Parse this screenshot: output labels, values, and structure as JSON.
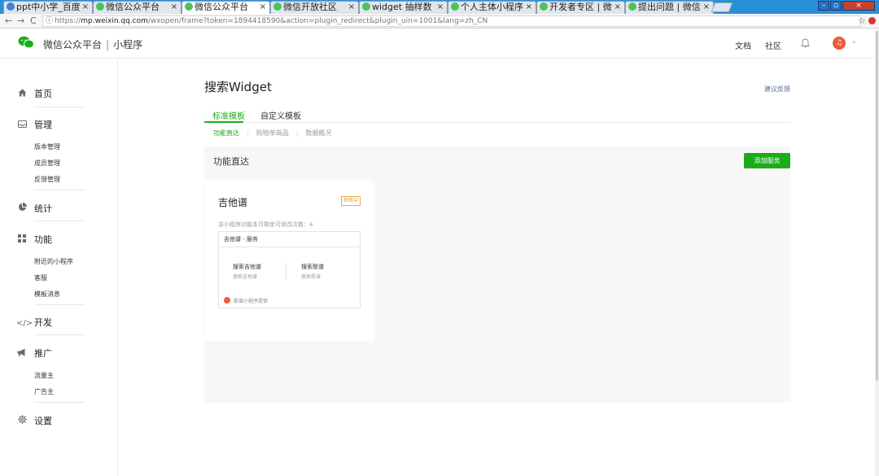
{
  "browser": {
    "tabs": [
      {
        "label": "ppt中小学_百度",
        "icon": "baidu"
      },
      {
        "label": "微信公众平台",
        "icon": "wechat"
      },
      {
        "label": "微信公众平台",
        "icon": "wechat",
        "active": true
      },
      {
        "label": "微信开放社区",
        "icon": "wechat"
      },
      {
        "label": "widget 抽样数",
        "icon": "wechat"
      },
      {
        "label": "个人主体小程序",
        "icon": "wechat"
      },
      {
        "label": "开发者专区 | 微",
        "icon": "wechat"
      },
      {
        "label": "提出问题 | 微信",
        "icon": "wechat"
      }
    ],
    "tab_close": "×",
    "url_scheme": "https://",
    "url_host": "mp.weixin.qq.com",
    "url_path": "/wxopen/frame?token=1894418590&action=plugin_redirect&plugin_uin=1001&lang=zh_CN",
    "back": "←",
    "forward": "→",
    "reload": "C",
    "star": "☆",
    "win_min": "–",
    "win_max": "▫",
    "win_close": "×"
  },
  "header": {
    "brand": "微信公众平台",
    "separator": "|",
    "section": "小程序",
    "docs": "文档",
    "community": "社区",
    "avatar_glyph": "♫",
    "caret": "⌄"
  },
  "sidebar": {
    "home": "首页",
    "manage": "管理",
    "manage_items": [
      "版本管理",
      "成员管理",
      "反馈管理"
    ],
    "stats": "统计",
    "features": "功能",
    "feature_items": [
      "附近的小程序",
      "客服",
      "模板消息"
    ],
    "dev": "开发",
    "promote": "推广",
    "promote_items": [
      "流量主",
      "广告主"
    ],
    "settings": "设置"
  },
  "main": {
    "title": "搜索Widget",
    "feedback": "建议反馈",
    "tabs": [
      "标准模板",
      "自定义模板"
    ],
    "subtabs": [
      "功能直达",
      "购物单商品",
      "数据概况"
    ],
    "section_title": "功能直达",
    "add_button": "添加服务",
    "card": {
      "title": "吉他谱",
      "status": "审核中",
      "remaining": "该小程序功能本月剩余可修改次数：4",
      "service_header": "吉他谱 - 服务",
      "services": [
        {
          "name": "搜索吉他谱",
          "desc": "搜索吉他谱"
        },
        {
          "name": "搜索歌谱",
          "desc": "搜索歌谱"
        }
      ],
      "provider": "歌谱小程序提供"
    }
  },
  "colors": {
    "accent": "#1aad19",
    "link": "#576b95",
    "badge": "#f0a646"
  }
}
